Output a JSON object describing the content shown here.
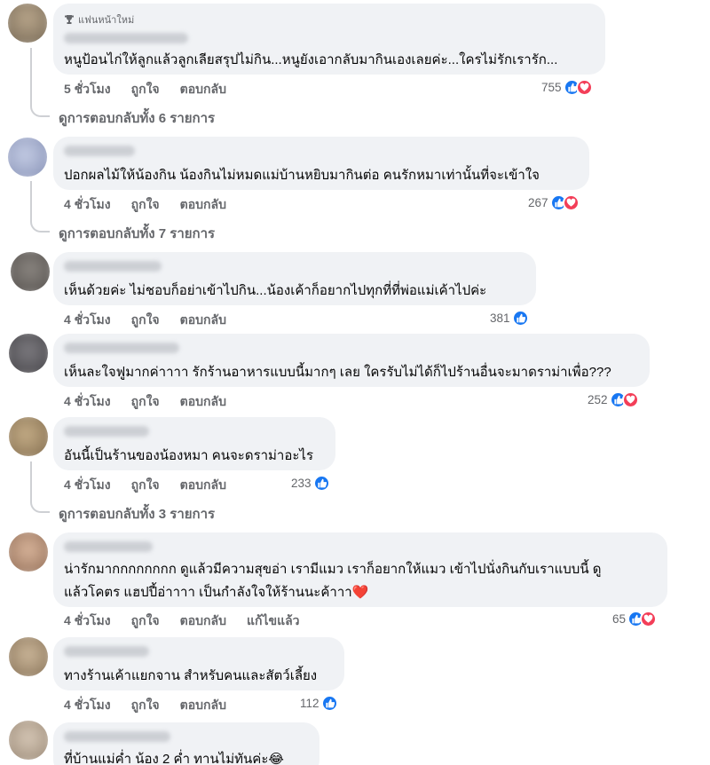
{
  "comments": [
    {
      "badge": "แฟนหน้าใหม่",
      "text": [
        "หนูป้อนไก่ให้ลูกแล้วลูกเลียสรุปไม่กิน...หนูยังเอากลับมากินเองเลยค่ะ...ใครไม่รักเรารัก..."
      ],
      "time": "5 ชั่วโมง",
      "like": "ถูกใจ",
      "reply": "ตอบกลับ",
      "count": "755",
      "love": true,
      "view_replies": "ดูการตอบกลับทั้ง 6 รายการ",
      "avatar_color": "#8a7a66"
    },
    {
      "text": [
        "ปอกผลไม้ให้น้องกิน น้องกินไม่หมดแม่บ้านหยิบมากินต่อ คนรักหมาเท่านั้นที่จะเข้าใจ"
      ],
      "time": "4 ชั่วโมง",
      "like": "ถูกใจ",
      "reply": "ตอบกลับ",
      "count": "267",
      "love": true,
      "view_replies": "ดูการตอบกลับทั้ง 7 รายการ",
      "avatar_color": "#9aa6c6"
    },
    {
      "text": [
        "เห็นด้วยค่ะ ไม่ชอบก็อย่าเข้าไปกิน...น้องเค้าก็อยากไปทุกที่ที่พ่อแม่เค้าไปค่ะ"
      ],
      "time": "4 ชั่วโมง",
      "like": "ถูกใจ",
      "reply": "ตอบกลับ",
      "count": "381",
      "love": false,
      "avatar_color": "#6e6a66"
    },
    {
      "text": [
        "เห็นละใจฟูมากค่าาาา รักร้านอาหารแบบนี้มากๆ เลย ใครรับไม่ได้ก็ไปร้านอื่นจะมาดราม่าเพื่อ???"
      ],
      "time": "4 ชั่วโมง",
      "like": "ถูกใจ",
      "reply": "ตอบกลับ",
      "count": "252",
      "love": true,
      "avatar_color": "#5c5b5e"
    },
    {
      "text": [
        "อันนี้เป็นร้านของน้องหมา คนจะดราม่าอะไร"
      ],
      "time": "4 ชั่วโมง",
      "like": "ถูกใจ",
      "reply": "ตอบกลับ",
      "count": "233",
      "love": false,
      "view_replies": "ดูการตอบกลับทั้ง 3 รายการ",
      "avatar_color": "#9c8462"
    },
    {
      "text": [
        "น่ารักมากกกกกกกก ดูแล้วมีความสุขอ่า เรามีแมว เราก็อยากให้แมว เข้าไปนั่งกินกับเราแบบนี้ ดู",
        "แล้วโคตร แฮปปี้อ่าาาา เป็นกำลังใจให้ร้านนะค้าาา❤️"
      ],
      "time": "4 ชั่วโมง",
      "like": "ถูกใจ",
      "reply": "ตอบกลับ",
      "edited": "แก้ไขแล้ว",
      "count": "65",
      "love": true,
      "avatar_color": "#b08a70"
    },
    {
      "text": [
        "ทางร้านเค้าแยกจาน สำหรับคนและสัตว์เลี้ยง"
      ],
      "time": "4 ชั่วโมง",
      "like": "ถูกใจ",
      "reply": "ตอบกลับ",
      "count": "112",
      "love": false,
      "avatar_color": "#a39074"
    },
    {
      "text": [
        "ที่บ้านแม่ค่ำ น้อง 2 ค่ำ ทานไม่ทันค่ะ😂"
      ],
      "avatar_color": "#b7a897"
    }
  ],
  "icons": {
    "like": "thumbs-up-icon",
    "love": "heart-icon",
    "badge": "trophy-icon"
  }
}
